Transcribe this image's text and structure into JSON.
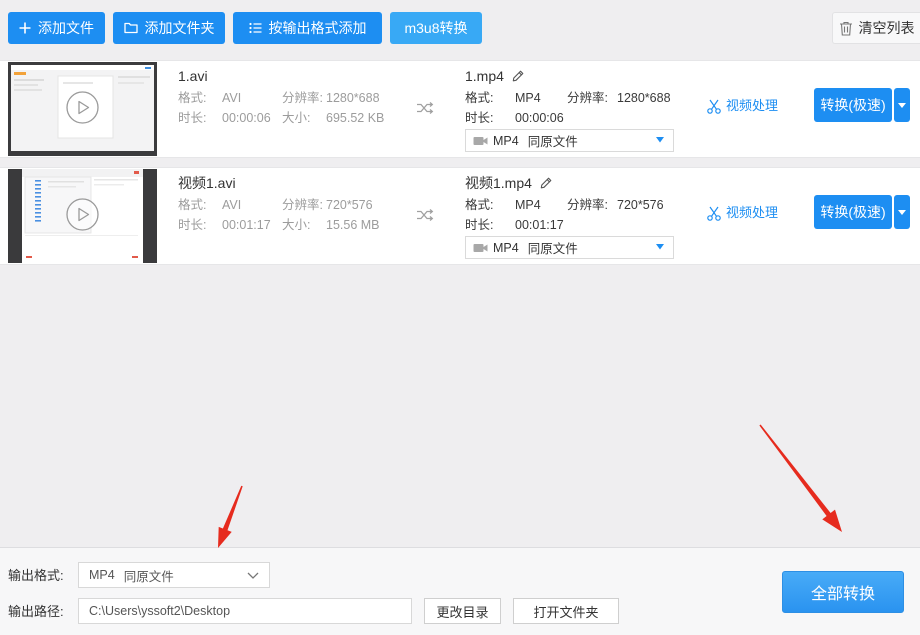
{
  "toolbar": {
    "add_file": {
      "label": "添加文件",
      "icon": "plus-icon"
    },
    "add_folder": {
      "label": "添加文件夹",
      "icon": "folder-icon"
    },
    "add_by_format": {
      "label": "按输出格式添加",
      "icon": "list-icon"
    },
    "m3u8": {
      "label": "m3u8转换"
    },
    "clear_list": {
      "label": "清空列表",
      "icon": "trash-icon"
    }
  },
  "labels": {
    "format": "格式:",
    "resolution": "分辨率:",
    "duration": "时长:",
    "size": "大小:"
  },
  "files": [
    {
      "input": {
        "name": "1.avi",
        "format": "AVI",
        "resolution": "1280*688",
        "duration": "00:00:06",
        "size": "695.52 KB"
      },
      "output": {
        "name": "1.mp4",
        "format": "MP4",
        "resolution": "1280*688",
        "duration": "00:00:06",
        "preset_format": "MP4",
        "preset_quality": "同原文件"
      },
      "video_process": "视频处理",
      "convert": "转换(极速)"
    },
    {
      "input": {
        "name": "视频1.avi",
        "format": "AVI",
        "resolution": "720*576",
        "duration": "00:01:17",
        "size": "15.56 MB"
      },
      "output": {
        "name": "视频1.mp4",
        "format": "MP4",
        "resolution": "720*576",
        "duration": "00:01:17",
        "preset_format": "MP4",
        "preset_quality": "同原文件"
      },
      "video_process": "视频处理",
      "convert": "转换(极速)"
    }
  ],
  "bottom": {
    "output_format_label": "输出格式:",
    "output_format_value": "MP4",
    "output_format_quality": "同原文件",
    "output_path_label": "输出路径:",
    "output_path_value": "C:\\Users\\yssoft2\\Desktop",
    "change_dir": "更改目录",
    "open_folder": "打开文件夹",
    "convert_all": "全部转换"
  },
  "colors": {
    "accent": "#1d8ef2",
    "m3u8_button": "#38a9f5",
    "annotation_arrow": "#e62b1e",
    "secondary_text": "#9c9c9c"
  }
}
